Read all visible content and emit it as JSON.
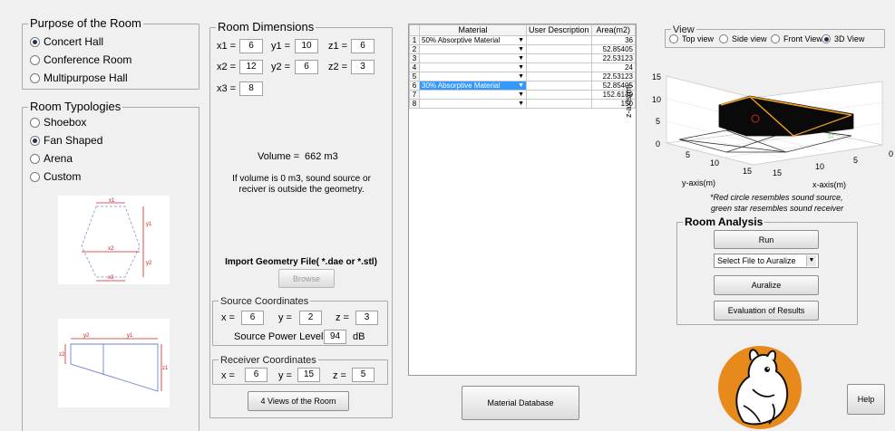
{
  "purpose": {
    "title": "Purpose of the Room",
    "options": [
      "Concert Hall",
      "Conference Room",
      "Multipurpose Hall"
    ],
    "selected": 0
  },
  "typologies": {
    "title": "Room Typologies",
    "options": [
      "Shoebox",
      "Fan Shaped",
      "Arena",
      "Custom"
    ],
    "selected": 1,
    "diagram_top": {
      "labels": [
        "x1",
        "x2",
        "x3",
        "y1",
        "y2"
      ]
    },
    "diagram_side": {
      "labels": [
        "y2",
        "y1",
        "z2",
        "z1"
      ]
    }
  },
  "dimensions": {
    "title": "Room Dimensions",
    "x1_label": "x1 =",
    "x1": "6",
    "y1_label": "y1 =",
    "y1": "10",
    "z1_label": "z1 =",
    "z1": "6",
    "x2_label": "x2 =",
    "x2": "12",
    "y2_label": "y2 =",
    "y2": "6",
    "z2_label": "z2 =",
    "z2": "3",
    "x3_label": "x3 =",
    "x3": "8",
    "volume_label": "Volume =",
    "volume_value": "662 m3",
    "volume_note": "If volume is 0 m3, sound source or reciver is outside the geometry.",
    "import_label": "Import Geometry File( *.dae or *.stl)",
    "browse_label": "Browse"
  },
  "source": {
    "title": "Source Coordinates",
    "x_label": "x =",
    "x": "6",
    "y_label": "y =",
    "y": "2",
    "z_label": "z =",
    "z": "3",
    "power_label": "Source Power Level =",
    "power": "94",
    "power_unit": "dB"
  },
  "receiver": {
    "title": "Receiver Coordinates",
    "x_label": "x =",
    "x": "6",
    "y_label": "y =",
    "y": "15",
    "z_label": "z =",
    "z": "5"
  },
  "views_button": "4 Views of the Room",
  "material_table": {
    "headers": [
      "Material",
      "User Description",
      "Area(m2)"
    ],
    "rows": [
      {
        "num": "1",
        "material": "50% Absorptive Material",
        "desc": "",
        "area": "36"
      },
      {
        "num": "2",
        "material": "",
        "desc": "",
        "area": "52.85405"
      },
      {
        "num": "3",
        "material": "",
        "desc": "",
        "area": "22.53123"
      },
      {
        "num": "4",
        "material": "",
        "desc": "",
        "area": "24"
      },
      {
        "num": "5",
        "material": "",
        "desc": "",
        "area": "22.53123"
      },
      {
        "num": "6",
        "material": "30% Absorptive Material",
        "desc": "",
        "area": "52.85405"
      },
      {
        "num": "7",
        "material": "",
        "desc": "",
        "area": "152.6139"
      },
      {
        "num": "8",
        "material": "",
        "desc": "",
        "area": "150"
      }
    ]
  },
  "material_db_button": "Material Database",
  "view": {
    "title": "View",
    "options": [
      "Top view",
      "Side view",
      "Front View",
      "3D View"
    ],
    "selected": 3,
    "z_axis_label": "z-axis(m)",
    "y_axis_label": "y-axis(m)",
    "x_axis_label": "x-axis(m)",
    "z_ticks": [
      "15",
      "10",
      "5",
      "0"
    ],
    "y_ticks": [
      "5",
      "10",
      "15"
    ],
    "x_ticks": [
      "15",
      "10",
      "5",
      "0"
    ],
    "caption_1": "*Red circle resembles sound source,",
    "caption_2": "green star resembles sound receiver"
  },
  "analysis": {
    "title": "Room Analysis",
    "run_label": "Run",
    "select_placeholder": "Select File to Auralize",
    "auralize_label": "Auralize",
    "evaluation_label": "Evaluation of Results"
  },
  "help_label": "Help",
  "colors": {
    "accent_select": "#3399ff",
    "logo_orange": "#e8891c",
    "highlight_edge": "#f0a020"
  }
}
